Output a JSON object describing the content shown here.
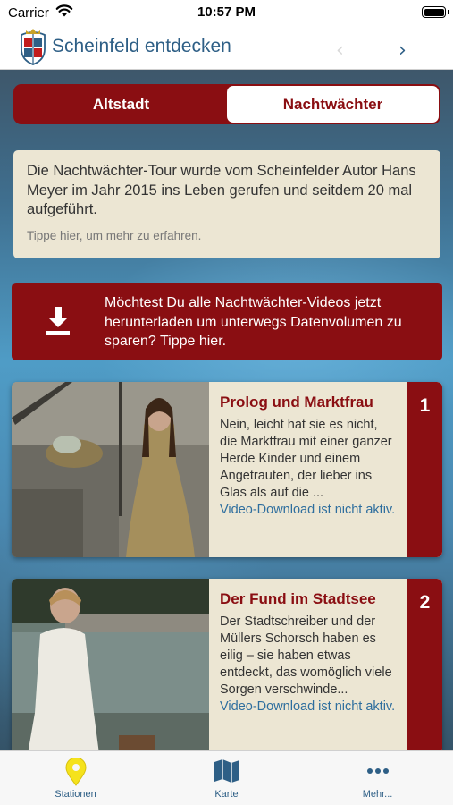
{
  "status_bar": {
    "carrier": "Carrier",
    "time": "10:57 PM"
  },
  "header": {
    "title": "Scheinfeld entdecken",
    "prev_icon": "chevron-left-icon",
    "next_icon": "chevron-right-icon"
  },
  "segments": {
    "altstadt": "Altstadt",
    "nachtwaechter": "Nachtwächter",
    "selected": "Nachtwächter"
  },
  "info": {
    "text": "Die Nachtwächter-Tour wurde vom Scheinfelder Autor Hans Meyer im Jahr 2015 ins Leben gerufen und seitdem 20 mal aufgeführt.",
    "more": "Tippe hier, um mehr zu erfahren."
  },
  "download_banner": {
    "text": "Möchtest Du alle Nachtwächter-Videos jetzt herunterladen um unterwegs Datenvolumen zu sparen? Tippe hier.",
    "icon": "download-icon"
  },
  "stations": [
    {
      "number": "1",
      "title": "Prolog und Marktfrau",
      "description": "Nein, leicht hat sie es nicht, die Marktfrau mit einer ganzer Herde Kinder und einem Angetrauten, der lieber ins Glas als auf die ...",
      "status": "Video-Download ist nicht aktiv."
    },
    {
      "number": "2",
      "title": "Der Fund im Stadtsee",
      "description": "Der Stadtschreiber und der Müllers Schorsch haben es eilig – sie haben etwas entdeckt, das womöglich viele Sorgen verschwinde...",
      "status": "Video-Download ist nicht aktiv."
    }
  ],
  "tabbar": {
    "stationen": "Stationen",
    "karte": "Karte",
    "mehr": "Mehr...",
    "selected": "Stationen"
  },
  "colors": {
    "brand_red": "#8a0e12",
    "brand_blue": "#2e5f86",
    "card_beige": "#ece6d3",
    "active_tab_icon": "#f5e21c"
  }
}
